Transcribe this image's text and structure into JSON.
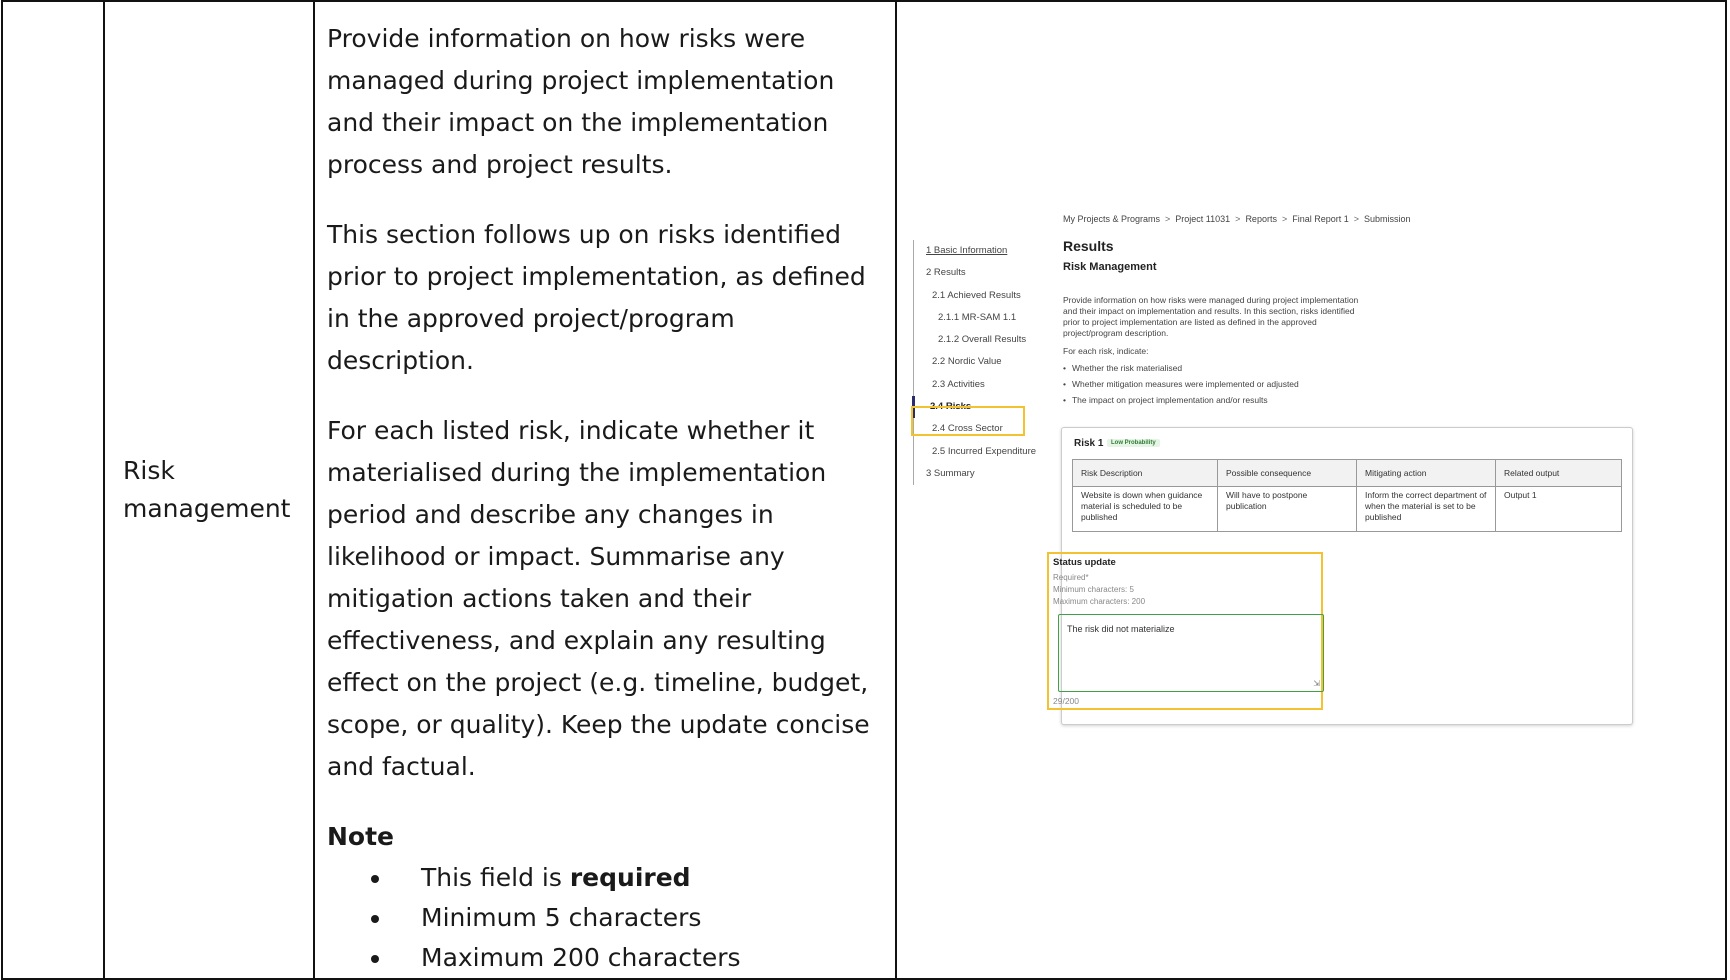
{
  "row": {
    "label": "Risk management",
    "paragraphs": [
      "Provide information on how risks were managed during project implementation and their impact on the implementation process and project results.",
      "This section follows up on risks identified prior to project implementation, as defined in the approved project/program description.",
      "For each listed risk, indicate whether it materialised during the implementation period and describe any changes in likelihood or impact. Summarise any mitigation actions taken and their effectiveness, and explain any resulting effect on the project (e.g. timeline, budget, scope, or quality). Keep the update concise and factual."
    ],
    "note_heading": "Note",
    "note_items": [
      {
        "before": "This field is ",
        "bold": "required"
      },
      {
        "before": "Minimum 5 characters",
        "bold": ""
      },
      {
        "before": "Maximum 200 characters",
        "bold": ""
      }
    ]
  },
  "screenshot": {
    "breadcrumb": [
      "My Projects & Programs",
      "Project 11031",
      "Reports",
      "Final Report 1",
      "Submission"
    ],
    "breadcrumb_sep": ">",
    "nav": [
      {
        "label": "1 Basic Information",
        "level": 0,
        "link": true
      },
      {
        "label": "2 Results",
        "level": 0
      },
      {
        "label": "2.1 Achieved Results",
        "level": 1
      },
      {
        "label": "2.1.1 MR-SAM 1.1",
        "level": 2
      },
      {
        "label": "2.1.2 Overall Results",
        "level": 2
      },
      {
        "label": "2.2 Nordic Value",
        "level": 1
      },
      {
        "label": "2.3 Activities",
        "level": 1
      },
      {
        "label": "2.4 Risks",
        "level": 1,
        "active": true
      },
      {
        "label": "2.4 Cross Sector",
        "level": 1
      },
      {
        "label": "2.5 Incurred Expenditure",
        "level": 1
      },
      {
        "label": "3 Summary",
        "level": 0
      }
    ],
    "title": "Results",
    "subtitle": "Risk Management",
    "intro_lines": [
      "Provide information on how risks were managed during project implementation",
      "and their impact on implementation and results. In this section, risks identified",
      "prior to project implementation are listed as defined in the approved",
      "project/program description."
    ],
    "for_each": "For each risk, indicate:",
    "bullets": [
      "Whether the risk materialised",
      "Whether mitigation measures were implemented or adjusted",
      "The impact on project implementation and/or results"
    ],
    "risk": {
      "title": "Risk 1",
      "badge": "Low Probability",
      "headers": [
        "Risk Description",
        "Possible consequence",
        "Mitigating action",
        "Related output"
      ],
      "row": [
        "Website is down when guidance material is scheduled to be published",
        "Will have to postpone publication",
        "Inform the correct department of when the material is set to be published",
        "Output 1"
      ]
    },
    "status": {
      "title": "Status update",
      "required": "Required*",
      "min": "Minimum characters: 5",
      "max": "Maximum characters: 200",
      "value": "The risk did not materialize",
      "counter": "29/200"
    }
  },
  "colors": {
    "highlight": "#f3c230",
    "input_border": "#43a047",
    "badge_text": "#2e7d32",
    "border": "#111111"
  }
}
